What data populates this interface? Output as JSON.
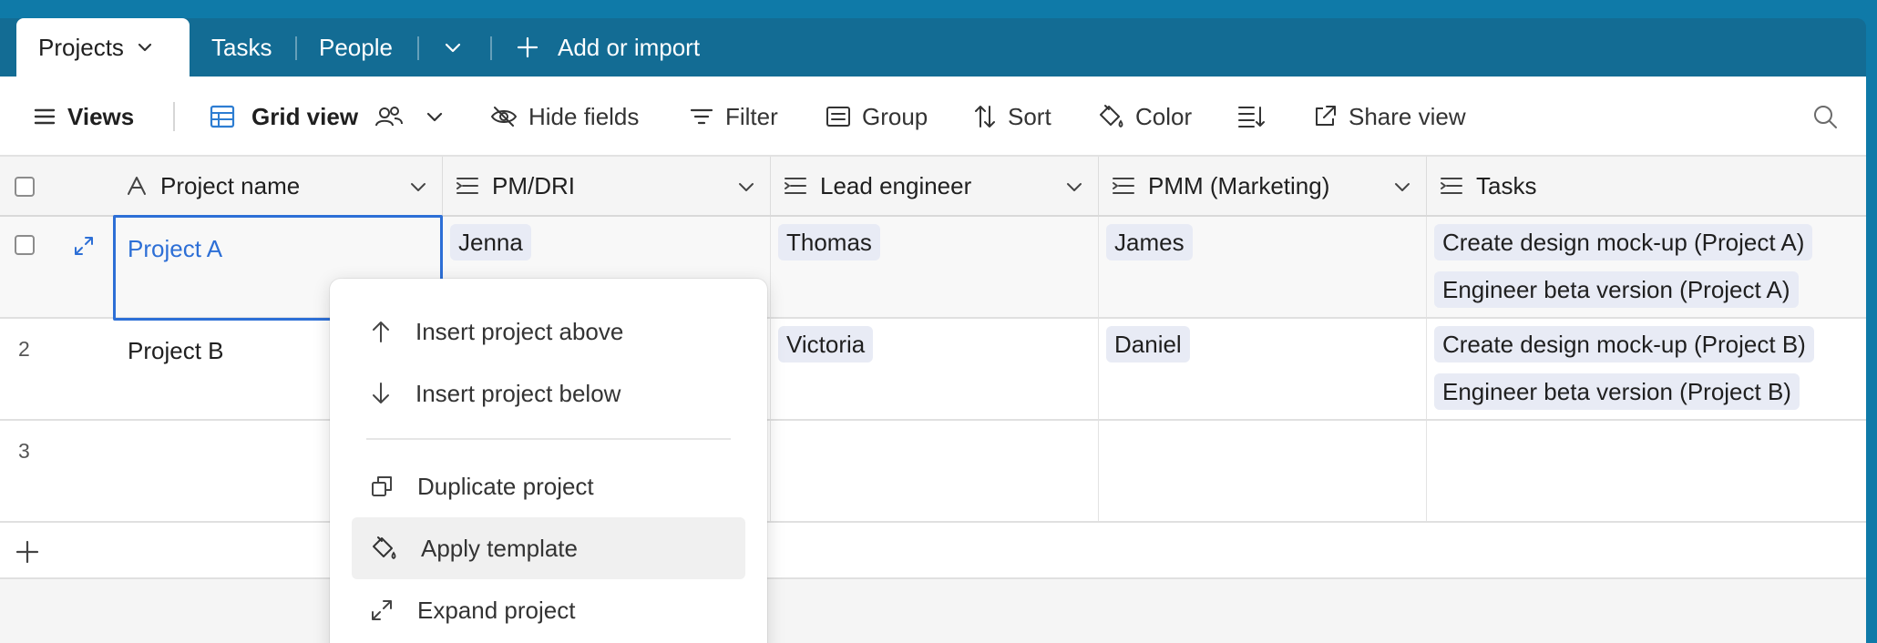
{
  "tabs": {
    "active": "Projects",
    "items": [
      "Tasks",
      "People"
    ],
    "add_label": "Add or import"
  },
  "toolbar": {
    "views": "Views",
    "grid_view": "Grid view",
    "hide_fields": "Hide fields",
    "filter": "Filter",
    "group": "Group",
    "sort": "Sort",
    "color": "Color",
    "share_view": "Share view"
  },
  "columns": [
    "Project name",
    "PM/DRI",
    "Lead engineer",
    "PMM (Marketing)",
    "Tasks"
  ],
  "rows": [
    {
      "name": "Project A",
      "pm": "Jenna",
      "lead": "Thomas",
      "pmm": "James",
      "tasks": [
        "Create design mock-up (Project A)",
        "Engineer beta version (Project A)"
      ]
    },
    {
      "num": "2",
      "name": "Project B",
      "lead": "Victoria",
      "pmm": "Daniel",
      "tasks": [
        "Create design mock-up (Project B)",
        "Engineer beta version (Project B)"
      ]
    },
    {
      "num": "3"
    }
  ],
  "context_menu": {
    "items": [
      "Insert project above",
      "Insert project below",
      "Duplicate project",
      "Apply template",
      "Expand project"
    ],
    "highlighted": "Apply template"
  },
  "colors": {
    "tabbar": "#136c94",
    "accent": "#2d6fd6",
    "pill": "#e8ebf5"
  }
}
